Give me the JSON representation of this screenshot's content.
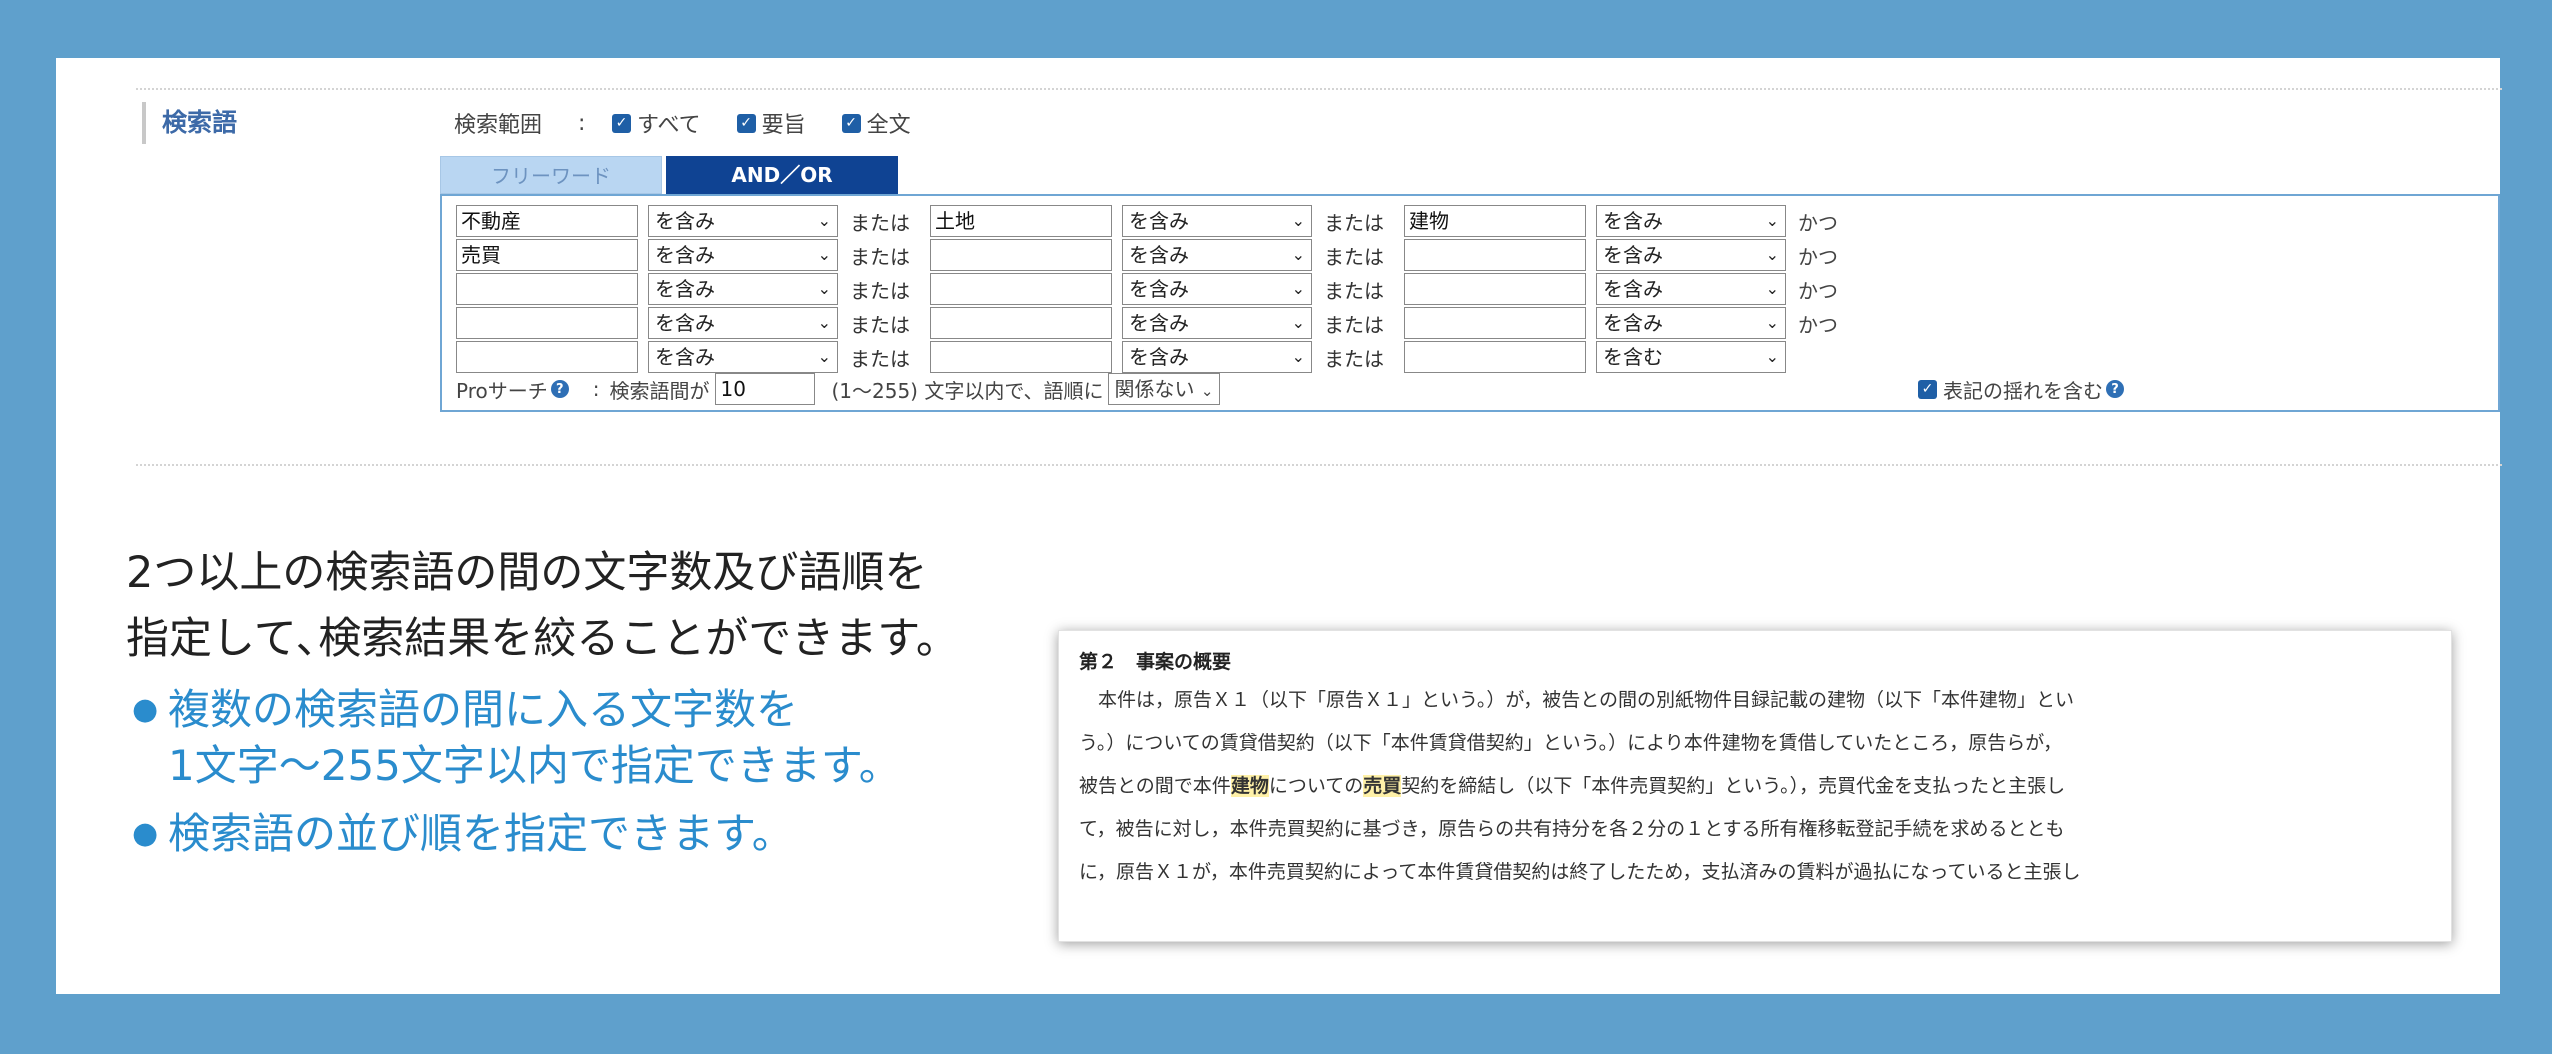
{
  "search_form": {
    "term_label": "検索語",
    "scope": {
      "label": "検索範囲",
      "colon": ":",
      "options": [
        {
          "label": "すべて",
          "checked": true
        },
        {
          "label": "要旨",
          "checked": true
        },
        {
          "label": "全文",
          "checked": true
        }
      ]
    },
    "tabs": [
      {
        "label": "フリーワード",
        "active": false
      },
      {
        "label": "AND／OR",
        "active": true
      }
    ],
    "rows": [
      {
        "fields": [
          "不動産",
          "土地",
          "建物"
        ],
        "selects": [
          "を含み",
          "を含み",
          "を含み"
        ],
        "connector": "または",
        "tail": "かつ"
      },
      {
        "fields": [
          "売買",
          "",
          ""
        ],
        "selects": [
          "を含み",
          "を含み",
          "を含み"
        ],
        "connector": "または",
        "tail": "かつ"
      },
      {
        "fields": [
          "",
          "",
          ""
        ],
        "selects": [
          "を含み",
          "を含み",
          "を含み"
        ],
        "connector": "または",
        "tail": "かつ"
      },
      {
        "fields": [
          "",
          "",
          ""
        ],
        "selects": [
          "を含み",
          "を含み",
          "を含み"
        ],
        "connector": "または",
        "tail": "かつ"
      },
      {
        "fields": [
          "",
          "",
          ""
        ],
        "selects": [
          "を含み",
          "を含み",
          "を含む"
        ],
        "connector": "または",
        "tail": ""
      }
    ],
    "pro_search": {
      "label": "Proサーチ",
      "colon": ":",
      "distance_label": "検索語間が",
      "distance_value": "10",
      "range_text": "(1〜255) 文字以内で、語順に",
      "order_value": "関係ない",
      "variant_label": "表記の揺れを含む",
      "variant_checked": true
    }
  },
  "description": {
    "line1": "2つ以上の検索語の間の文字数及び語順を",
    "line2": "指定して､検索結果を絞ることができます。"
  },
  "bullets": [
    {
      "lines": [
        "複数の検索語の間に入る文字数を",
        "1文字〜255文字以内で指定できます。"
      ]
    },
    {
      "lines": [
        "検索語の並び順を指定できます。"
      ]
    }
  ],
  "excerpt": {
    "heading": "第２　事案の概要",
    "line1": "本件は，原告Ｘ１（以下「原告Ｘ１」という。）が，被告との間の別紙物件目録記載の建物（以下「本件建物」とい",
    "line2": "う。）についての賃貸借契約（以下「本件賃貸借契約」という。）により本件建物を賃借していたところ，原告らが，",
    "line3_pre": "被告との間で本件",
    "line3_hl1": "建物",
    "line3_mid": "についての",
    "line3_hl2": "売買",
    "line3_post": "契約を締結し（以下「本件売買契約」という。），売買代金を支払ったと主張し",
    "line4": "て，被告に対し，本件売買契約に基づき，原告らの共有持分を各２分の１とする所有権移転登記手続を求めるととも",
    "line5": "に，原告Ｘ１が，本件売買契約によって本件賃貸借契約は終了したため，支払済みの賃料が過払になっていると主張し"
  }
}
